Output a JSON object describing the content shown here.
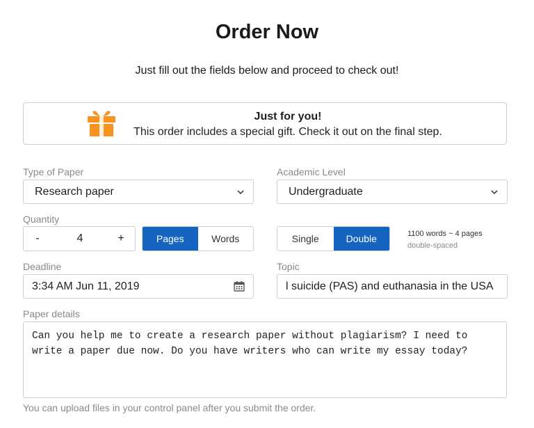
{
  "header": {
    "title": "Order Now",
    "subtitle": "Just fill out the fields below and proceed to check out!"
  },
  "gift_banner": {
    "heading": "Just for you!",
    "description": "This order includes a special gift. Check it out on the final step.",
    "icon": "gift-icon",
    "icon_color": "#f7931e"
  },
  "form": {
    "type_of_paper": {
      "label": "Type of Paper",
      "value": "Research paper"
    },
    "academic_level": {
      "label": "Academic Level",
      "value": "Undergraduate"
    },
    "quantity": {
      "label": "Quantity",
      "value": "4",
      "decrement": "-",
      "increment": "+",
      "units": [
        "Pages",
        "Words"
      ],
      "active_unit": "Pages"
    },
    "spacing": {
      "options": [
        "Single",
        "Double"
      ],
      "active": "Double",
      "info_line1": "1100 words ~ 4 pages",
      "info_line2": "double-spaced"
    },
    "deadline": {
      "label": "Deadline",
      "value": "3:34 AM Jun 11, 2019"
    },
    "topic": {
      "label": "Topic",
      "value": "l suicide (PAS) and euthanasia in the USA"
    },
    "paper_details": {
      "label": "Paper details",
      "value": "Can you help me to create a research paper without plagiarism? I need to write a paper due now. Do you have writers who can write my essay today?"
    },
    "upload_note": "You can upload files in your control panel after you submit the order."
  },
  "colors": {
    "accent": "#1565c0",
    "border": "#cfcfcf",
    "muted_text": "#8a8a8a"
  }
}
